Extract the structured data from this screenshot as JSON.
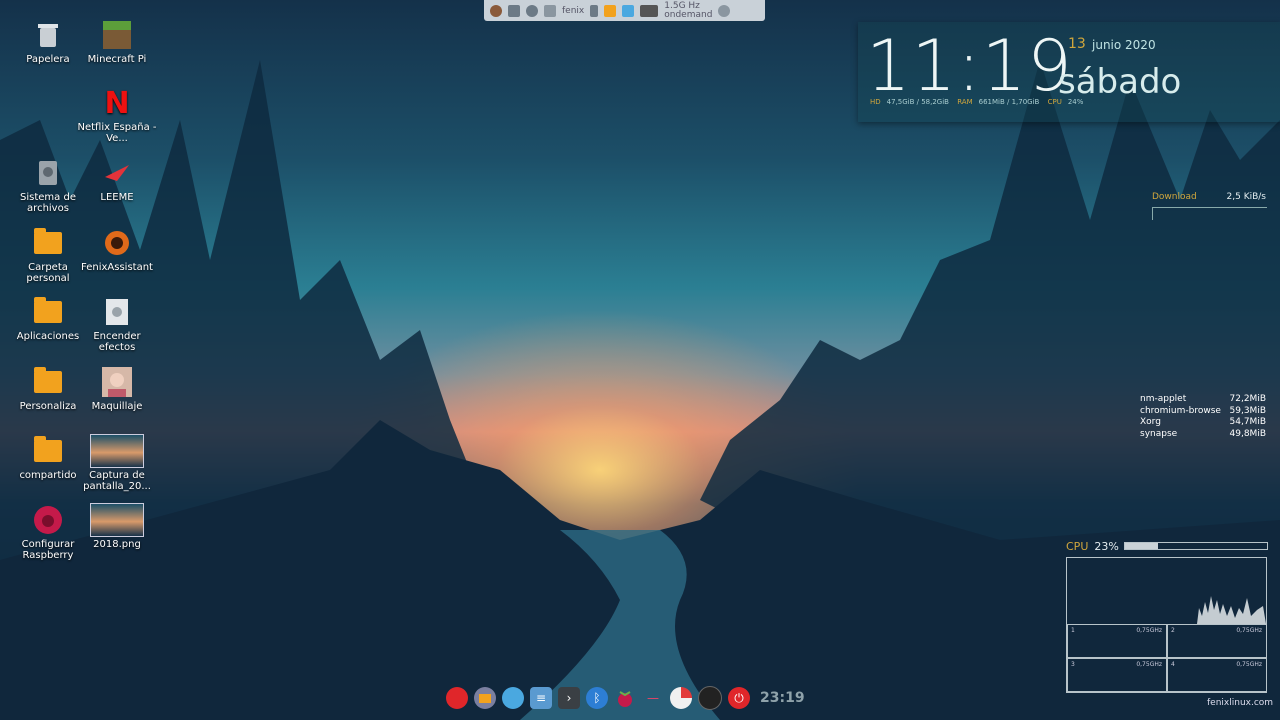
{
  "desktop": {
    "icons": [
      {
        "label": "Papelera",
        "icon": "trash-icon"
      },
      {
        "label": "Minecraft Pi",
        "icon": "minecraft-icon"
      },
      {
        "label": "Netflix España - Ve...",
        "icon": "netflix-icon"
      },
      {
        "label": "Sistema de archivos",
        "icon": "drive-icon"
      },
      {
        "label": "LEEME",
        "icon": "leeme-icon"
      },
      {
        "label": "Carpeta personal",
        "icon": "home-folder-icon"
      },
      {
        "label": "FenixAssistant",
        "icon": "fenix-icon"
      },
      {
        "label": "Aplicaciones",
        "icon": "folder-icon"
      },
      {
        "label": "Encender efectos",
        "icon": "gear-file-icon"
      },
      {
        "label": "Personaliza",
        "icon": "folder-icon"
      },
      {
        "label": "Maquillaje",
        "icon": "photo-icon"
      },
      {
        "label": "compartido",
        "icon": "shared-folder-icon"
      },
      {
        "label": "Captura de pantalla_20...",
        "icon": "screenshot-thumbnail"
      },
      {
        "label": "Configurar Raspberry",
        "icon": "raspberry-icon"
      },
      {
        "label": "2018.png",
        "icon": "image-thumbnail"
      }
    ]
  },
  "top_panel": {
    "user": "fenix",
    "cpu_freq": "1.5G Hz",
    "governor": "ondemand"
  },
  "clock": {
    "time": "11:19",
    "day": "13",
    "month_year": "junio 2020",
    "weekday": "sábado",
    "hd_label": "HD",
    "hd_value": "47,5GiB / 58,2GiB",
    "ram_label": "RAM",
    "ram_value": "661MiB / 1,70GiB",
    "cpu_label": "CPU",
    "cpu_value": "24%"
  },
  "network": {
    "download_label": "Download",
    "download_value": "2,5 KiB/s"
  },
  "processes": [
    {
      "name": "nm-applet",
      "mem": "72,2MiB"
    },
    {
      "name": "chromium-browse",
      "mem": "59,3MiB"
    },
    {
      "name": "Xorg",
      "mem": "54,7MiB"
    },
    {
      "name": "synapse",
      "mem": "49,8MiB"
    }
  ],
  "cpu_widget": {
    "label": "CPU",
    "value": "23%",
    "level": 0.23,
    "cores": [
      {
        "num": "1",
        "freq": "0,75GHz"
      },
      {
        "num": "2",
        "freq": "0,75GHz"
      },
      {
        "num": "3",
        "freq": "0,75GHz"
      },
      {
        "num": "4",
        "freq": "0,75GHz"
      }
    ]
  },
  "footer": "fenixlinux.com",
  "dock": {
    "items": [
      "fenix-menu-icon",
      "files-icon",
      "browser-icon",
      "text-editor-icon",
      "terminal-icon",
      "bluetooth-icon",
      "raspberry-icon",
      "volume-icon",
      "pie-chart-icon",
      "clock-icon",
      "power-icon"
    ],
    "time": "23:19"
  },
  "colors": {
    "accent": "#d0a63c",
    "power": "#e0262a",
    "raspberry": "#c51a4a"
  }
}
